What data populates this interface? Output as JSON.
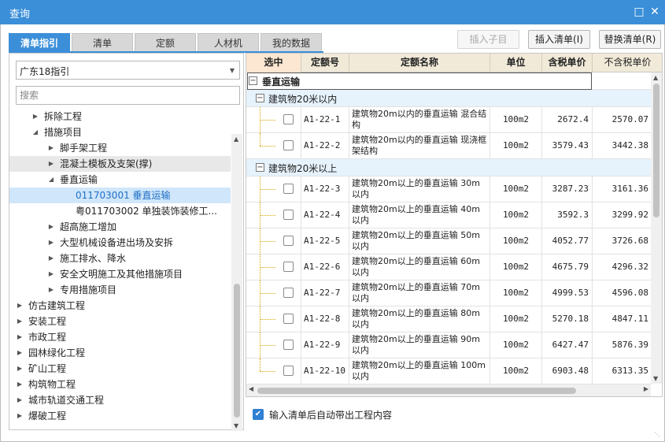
{
  "window": {
    "title": "查询",
    "maximize_icon": "maximize-icon",
    "close_icon": "close-icon",
    "accent_color": "#3b8fd9"
  },
  "tabs": [
    {
      "label": "清单指引",
      "active": true
    },
    {
      "label": "清单",
      "active": false
    },
    {
      "label": "定额",
      "active": false
    },
    {
      "label": "人材机",
      "active": false
    },
    {
      "label": "我的数据",
      "active": false
    }
  ],
  "toolbar": {
    "insert_child": "插入子目",
    "insert_list": "插入清单(I)",
    "replace_list": "替换清单(R)"
  },
  "left": {
    "guide_select": "广东18指引",
    "search_placeholder": "搜索",
    "tree": [
      {
        "label": "拆除工程",
        "level": 2,
        "arrow": "collapsed"
      },
      {
        "label": "措施项目",
        "level": 2,
        "arrow": "expanded"
      },
      {
        "label": "脚手架工程",
        "level": 3,
        "arrow": "collapsed"
      },
      {
        "label": "混凝土模板及支架(撑)",
        "level": 3,
        "arrow": "collapsed",
        "state": "hover"
      },
      {
        "label": "垂直运输",
        "level": 3,
        "arrow": "expanded"
      },
      {
        "label": "011703001  垂直运输",
        "level": 4,
        "arrow": "none",
        "state": "selected"
      },
      {
        "label": "粤011703002  单独装饰装修工...",
        "level": 4,
        "arrow": "none"
      },
      {
        "label": "超高施工增加",
        "level": 3,
        "arrow": "collapsed"
      },
      {
        "label": "大型机械设备进出场及安拆",
        "level": 3,
        "arrow": "collapsed"
      },
      {
        "label": "施工排水、降水",
        "level": 3,
        "arrow": "collapsed"
      },
      {
        "label": "安全文明施工及其他措施项目",
        "level": 3,
        "arrow": "collapsed"
      },
      {
        "label": "专用措施项目",
        "level": 3,
        "arrow": "collapsed"
      },
      {
        "label": "仿古建筑工程",
        "level": 1,
        "arrow": "collapsed"
      },
      {
        "label": "安装工程",
        "level": 1,
        "arrow": "collapsed"
      },
      {
        "label": "市政工程",
        "level": 1,
        "arrow": "collapsed"
      },
      {
        "label": "园林绿化工程",
        "level": 1,
        "arrow": "collapsed"
      },
      {
        "label": "矿山工程",
        "level": 1,
        "arrow": "collapsed"
      },
      {
        "label": "构筑物工程",
        "level": 1,
        "arrow": "collapsed"
      },
      {
        "label": "城市轨道交通工程",
        "level": 1,
        "arrow": "collapsed"
      },
      {
        "label": "爆破工程",
        "level": 1,
        "arrow": "collapsed"
      }
    ]
  },
  "grid": {
    "columns": [
      "选中",
      "定额号",
      "定额名称",
      "单位",
      "含税单价",
      "不含税单价"
    ],
    "group_title": "垂直运输",
    "subgroups": [
      {
        "title": "建筑物20米以内",
        "rows": [
          {
            "code": "A1-22-1",
            "name": "建筑物20m以内的垂直运输 混合结构",
            "unit": "100m2",
            "tax_price": "2672.4",
            "notax_price": "2570.07"
          },
          {
            "code": "A1-22-2",
            "name": "建筑物20m以内的垂直运输 现浇框架结构",
            "unit": "100m2",
            "tax_price": "3579.43",
            "notax_price": "3442.38"
          }
        ]
      },
      {
        "title": "建筑物20米以上",
        "rows": [
          {
            "code": "A1-22-3",
            "name": "建筑物20m以上的垂直运输 30m以内",
            "unit": "100m2",
            "tax_price": "3287.23",
            "notax_price": "3161.36"
          },
          {
            "code": "A1-22-4",
            "name": "建筑物20m以上的垂直运输 40m以内",
            "unit": "100m2",
            "tax_price": "3592.3",
            "notax_price": "3299.92"
          },
          {
            "code": "A1-22-5",
            "name": "建筑物20m以上的垂直运输 50m以内",
            "unit": "100m2",
            "tax_price": "4052.77",
            "notax_price": "3726.68"
          },
          {
            "code": "A1-22-6",
            "name": "建筑物20m以上的垂直运输 60m以内",
            "unit": "100m2",
            "tax_price": "4675.79",
            "notax_price": "4296.32"
          },
          {
            "code": "A1-22-7",
            "name": "建筑物20m以上的垂直运输 70m以内",
            "unit": "100m2",
            "tax_price": "4999.53",
            "notax_price": "4596.08"
          },
          {
            "code": "A1-22-8",
            "name": "建筑物20m以上的垂直运输 80m以内",
            "unit": "100m2",
            "tax_price": "5270.18",
            "notax_price": "4847.11"
          },
          {
            "code": "A1-22-9",
            "name": "建筑物20m以上的垂直运输 90m以内",
            "unit": "100m2",
            "tax_price": "6427.47",
            "notax_price": "5876.39"
          },
          {
            "code": "A1-22-10",
            "name": "建筑物20m以上的垂直运输 100m以内",
            "unit": "100m2",
            "tax_price": "6903.48",
            "notax_price": "6313.35"
          }
        ]
      }
    ]
  },
  "footer": {
    "auto_label": "输入清单后自动带出工程内容",
    "auto_checked": true
  }
}
